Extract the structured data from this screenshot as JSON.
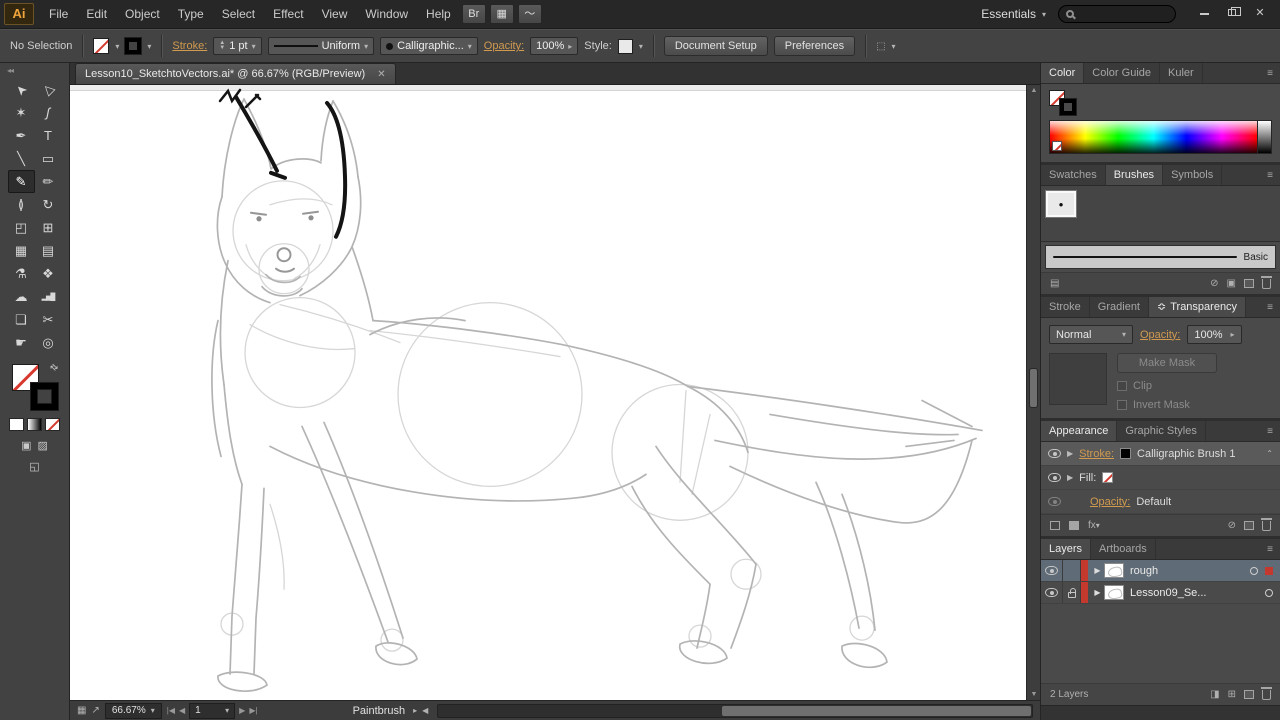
{
  "titlebar": {
    "logo": "Ai",
    "menus": [
      "File",
      "Edit",
      "Object",
      "Type",
      "Select",
      "Effect",
      "View",
      "Window",
      "Help"
    ],
    "bridge": "Br",
    "workspace": "Essentials"
  },
  "controlbar": {
    "selection_status": "No Selection",
    "stroke_label": "Stroke:",
    "stroke_value": "1 pt",
    "width_profile": "Uniform",
    "brush_type": "Calligraphic...",
    "opacity_label": "Opacity:",
    "opacity_value": "100%",
    "style_label": "Style:",
    "document_setup_btn": "Document Setup",
    "preferences_btn": "Preferences"
  },
  "document": {
    "tab_title": "Lesson10_SketchtoVectors.ai* @ 66.67% (RGB/Preview)"
  },
  "panels": {
    "color": {
      "tabs": [
        "Color",
        "Color Guide",
        "Kuler"
      ]
    },
    "brushes": {
      "tabs": [
        "Swatches",
        "Brushes",
        "Symbols"
      ],
      "selected_brush_dot": "•",
      "brush_name": "Basic"
    },
    "transparency": {
      "tabs": [
        "Stroke",
        "Gradient",
        "Transparency"
      ],
      "blend_mode": "Normal",
      "opacity_label": "Opacity:",
      "opacity_value": "100%",
      "make_mask_btn": "Make Mask",
      "clip_label": "Clip",
      "invert_mask_label": "Invert Mask"
    },
    "appearance": {
      "tabs": [
        "Appearance",
        "Graphic Styles"
      ],
      "stroke_label": "Stroke:",
      "stroke_value": "Calligraphic Brush 1",
      "fill_label": "Fill:",
      "opacity_label": "Opacity:",
      "opacity_value": "Default",
      "fx_label": "fx"
    },
    "layers": {
      "tabs": [
        "Layers",
        "Artboards"
      ],
      "rows": [
        {
          "name": "rough"
        },
        {
          "name": "Lesson09_Se..."
        }
      ],
      "count_label": "2 Layers"
    }
  },
  "statusbar": {
    "zoom": "66.67%",
    "frame": "1",
    "tool_label": "Paintbrush"
  },
  "colors": {
    "layer_color": "#c3392e",
    "link_label": "#d09a50",
    "selection_highlight": "#5f6b76",
    "logo_accent": "#f0a53c"
  }
}
